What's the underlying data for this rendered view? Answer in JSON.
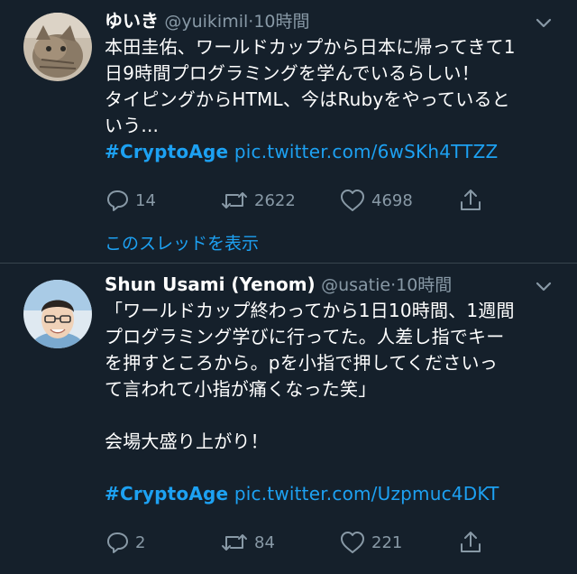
{
  "tweets": [
    {
      "name": "ゆいき",
      "handle": "@yuikimil",
      "dot": "·",
      "time": "10時間",
      "text": "本田圭佑、ワールドカップから日本に帰ってきて1\n日9時間プログラミングを学んでいるらしい！\nタイピングからHTML、今はRubyをやっていると\nいう...",
      "hashtag": "#CryptoAge",
      "link": "pic.twitter.com/6wSKh4TTZZ",
      "replies": "14",
      "retweets": "2622",
      "likes": "4698",
      "show_thread": "このスレッドを表示"
    },
    {
      "name": "Shun Usami (Yenom)",
      "handle": "@usatie",
      "dot": "·",
      "time": "10時間",
      "text": "「ワールドカップ終わってから1日10時間、1週間\nプログラミング学びに行ってた。人差し指でキー\nを押すところから。pを小指で押してくださいっ\nて言われて小指が痛くなった笑」\n\n会場大盛り上がり！",
      "hashtag": "#CryptoAge",
      "link": "pic.twitter.com/Uzpmuc4DKT",
      "replies": "2",
      "retweets": "84",
      "likes": "221"
    }
  ],
  "icons": {
    "reply": "reply-icon",
    "retweet": "retweet-icon",
    "like": "heart-icon",
    "share": "share-icon",
    "menu": "chevron-down-icon"
  },
  "colors": {
    "background": "#15202b",
    "accent": "#1da1f2",
    "muted": "#8899a6",
    "divider": "#38444d"
  }
}
